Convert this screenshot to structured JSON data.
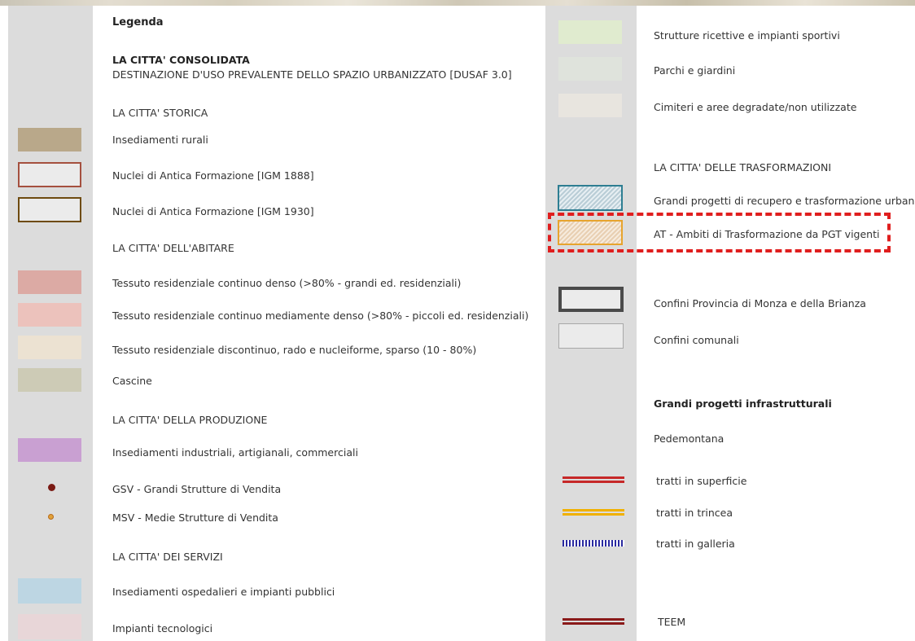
{
  "legend": {
    "title": "Legenda",
    "section_consolidata": "LA CITTA' CONSOLIDATA",
    "subtitle_dusaf": "DESTINAZIONE D'USO PREVALENTE DELLO SPAZIO URBANIZZATO [DUSAF 3.0]",
    "left": [
      {
        "kind": "heading",
        "label": "LA CITTA' STORICA"
      },
      {
        "kind": "item",
        "label": "Insediamenti rurali",
        "color": "#b9a88a"
      },
      {
        "kind": "item",
        "label": "Nuclei di Antica Formazione [IGM 1888]",
        "color": "#a5503f"
      },
      {
        "kind": "item",
        "label": "Nuclei di Antica Formazione [IGM 1930]",
        "color": "#6e4b10"
      },
      {
        "kind": "heading",
        "label": "LA CITTA' DELL'ABITARE"
      },
      {
        "kind": "item",
        "label": "Tessuto residenziale continuo denso (>80% - grandi ed. residenziali)",
        "color": "#dcaaa4"
      },
      {
        "kind": "item",
        "label": "Tessuto residenziale continuo mediamente denso (>80% - piccoli ed. residenziali)",
        "color": "#ecc2bc"
      },
      {
        "kind": "item",
        "label": "Tessuto residenziale discontinuo, rado e nucleiforme, sparso  (10 - 80%)",
        "color": "#ece2d2"
      },
      {
        "kind": "item",
        "label": "Cascine",
        "color": "#cdcbb6"
      },
      {
        "kind": "heading",
        "label": "LA CITTA' DELLA PRODUZIONE"
      },
      {
        "kind": "item",
        "label": "Insediamenti industriali, artigianali, commerciali",
        "color": "#c9a0d2"
      },
      {
        "kind": "item",
        "label": "GSV - Grandi Strutture di Vendita",
        "color": "#7a1a14"
      },
      {
        "kind": "item",
        "label": "MSV - Medie Strutture di Vendita",
        "color": "#e0a23a"
      },
      {
        "kind": "heading",
        "label": "LA CITTA' DEI SERVIZI"
      },
      {
        "kind": "item",
        "label": "Insediamenti ospedalieri e impianti pubblici",
        "color": "#bdd6e3"
      },
      {
        "kind": "item",
        "label": "Impianti tecnologici",
        "color": "#e8d6d8"
      }
    ],
    "right": [
      {
        "kind": "item",
        "label": "Strutture ricettive e impianti sportivi",
        "color": "#e0ebcf"
      },
      {
        "kind": "item",
        "label": "Parchi e giardini",
        "color": "#dfe3dc"
      },
      {
        "kind": "item",
        "label": "Cimiteri e aree degradate/non utilizzate",
        "color": "#e8e5df"
      },
      {
        "kind": "heading",
        "label": "LA CITTA' DELLE TRASFORMAZIONI"
      },
      {
        "kind": "item",
        "label": "Grandi progetti di recupero e trasformazione urbana",
        "color": "#2e7e92"
      },
      {
        "kind": "item",
        "label": "AT - Ambiti di Trasformazione da PGT vigenti",
        "color": "#e7a42e",
        "highlighted": true
      },
      {
        "kind": "item",
        "label": "Confini Provincia di Monza e della Brianza",
        "color": "#4a4a4a"
      },
      {
        "kind": "item",
        "label": "Confini comunali",
        "color": "#a8a8a8"
      },
      {
        "kind": "heading",
        "label": "Grandi progetti infrastrutturali"
      },
      {
        "kind": "heading",
        "label": "Pedemontana"
      },
      {
        "kind": "item",
        "label": "tratti in superficie",
        "color": "#c62828"
      },
      {
        "kind": "item",
        "label": "tratti in trincea",
        "color": "#f0b000"
      },
      {
        "kind": "item",
        "label": "tratti in galleria",
        "color": "#2a2aa0"
      },
      {
        "kind": "item",
        "label": "TEEM",
        "color": "#8a1a1a"
      }
    ],
    "highlight_color": "#e01e1e"
  }
}
